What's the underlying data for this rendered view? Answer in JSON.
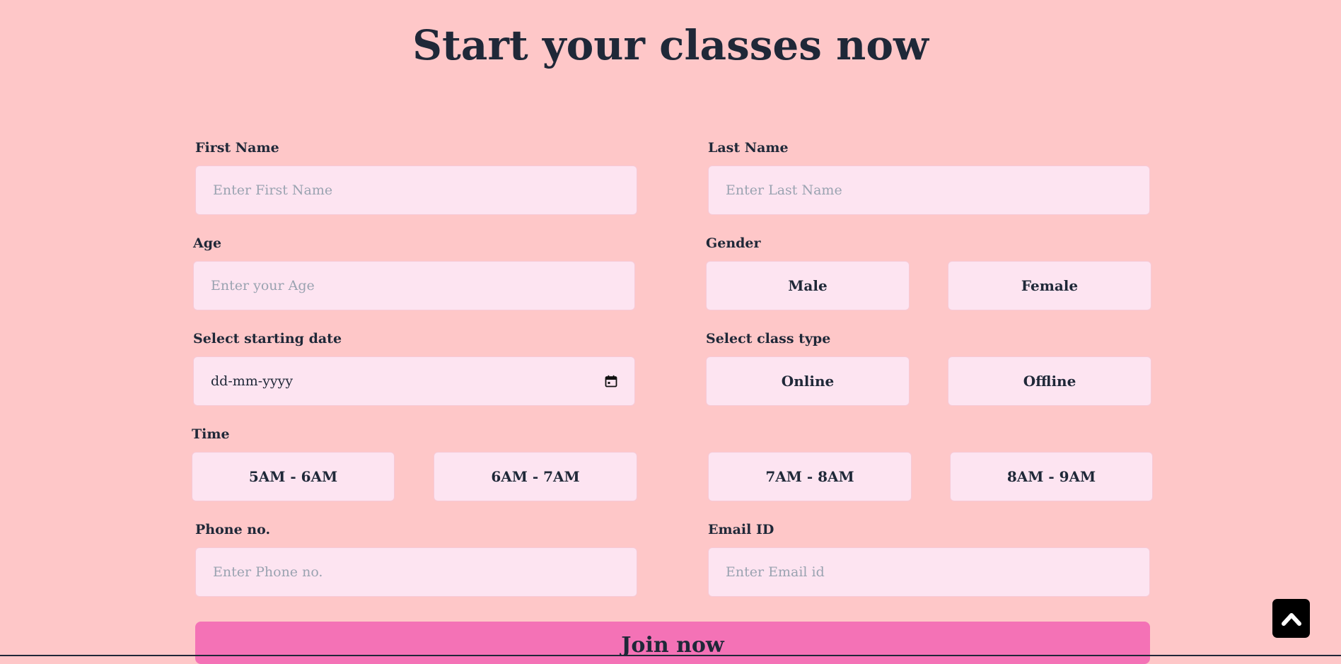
{
  "page": {
    "title": "Start your classes now"
  },
  "form": {
    "first_name": {
      "label": "First Name",
      "placeholder": "Enter First Name"
    },
    "last_name": {
      "label": "Last Name",
      "placeholder": "Enter Last Name"
    },
    "age": {
      "label": "Age",
      "placeholder": "Enter your Age"
    },
    "gender": {
      "label": "Gender",
      "options": [
        "Male",
        "Female"
      ]
    },
    "start_date": {
      "label": "Select starting date",
      "value": "dd-mm-yyyy",
      "icon": "calendar-icon"
    },
    "class_type": {
      "label": "Select class type",
      "options": [
        "Online",
        "Offline"
      ]
    },
    "time": {
      "label": "Time",
      "options": [
        "5AM - 6AM",
        "6AM - 7AM",
        "7AM - 8AM",
        "8AM - 9AM"
      ]
    },
    "phone": {
      "label": "Phone no.",
      "placeholder": "Enter Phone no."
    },
    "email": {
      "label": "Email ID",
      "placeholder": "Enter Email id"
    },
    "submit_label": "Join now"
  },
  "scroll_top": {
    "icon": "chevron-up-icon"
  },
  "colors": {
    "background": "#fec7c8",
    "field": "#fde4f1",
    "accent": "#f472b6",
    "text": "#1f2838"
  }
}
